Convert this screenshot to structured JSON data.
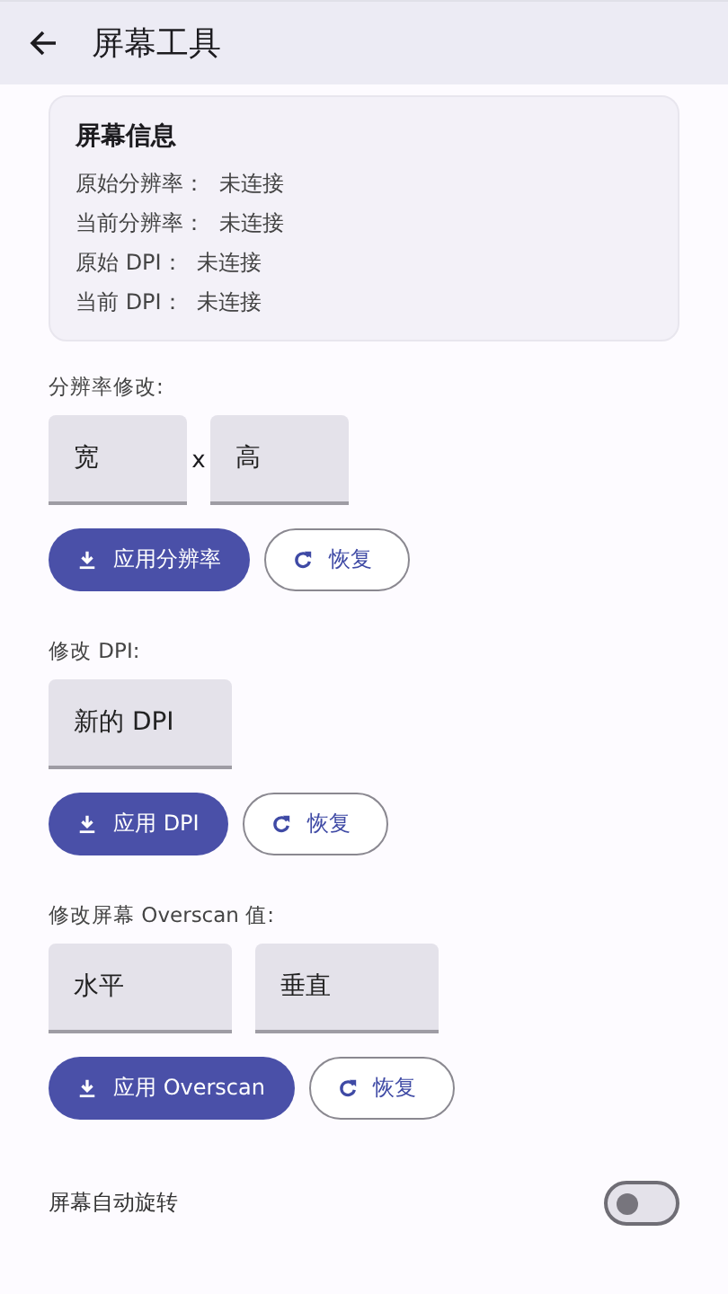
{
  "app_bar": {
    "title": "屏幕工具"
  },
  "info_card": {
    "title": "屏幕信息",
    "rows": [
      {
        "label": "原始分辨率：",
        "value": "未连接"
      },
      {
        "label": "当前分辨率：",
        "value": "未连接"
      },
      {
        "label": "原始 DPI：",
        "value": "未连接"
      },
      {
        "label": "当前 DPI：",
        "value": "未连接"
      }
    ]
  },
  "sections": [
    {
      "label": "分辨率修改:",
      "fields": [
        {
          "placeholder": "宽"
        },
        {
          "placeholder": "高"
        }
      ],
      "separator": "x",
      "apply_button": "应用分辨率",
      "reset_button": "恢复"
    },
    {
      "label": "修改 DPI:",
      "fields": [
        {
          "placeholder": "新的 DPI"
        }
      ],
      "apply_button": "应用 DPI",
      "reset_button": "恢复"
    },
    {
      "label": "修改屏幕 Overscan 值:",
      "fields": [
        {
          "placeholder": "水平"
        },
        {
          "placeholder": "垂直"
        }
      ],
      "apply_button": "应用 Overscan",
      "reset_button": "恢复"
    }
  ],
  "auto_rotate": {
    "label": "屏幕自动旋转",
    "on": false
  }
}
